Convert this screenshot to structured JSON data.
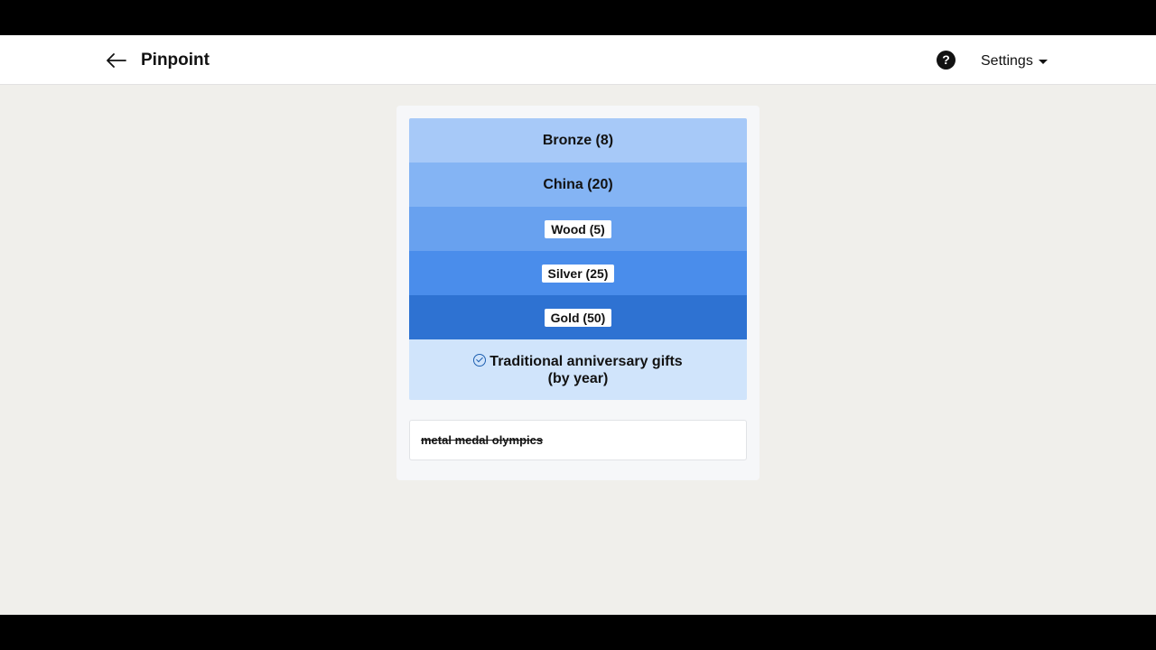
{
  "header": {
    "title": "Pinpoint",
    "help_label": "?",
    "settings_label": "Settings"
  },
  "clues": [
    {
      "label": "Bronze (8)"
    },
    {
      "label": "China (20)"
    },
    {
      "label": "Wood (5)"
    },
    {
      "label": "Silver (25)"
    },
    {
      "label": "Gold (50)"
    }
  ],
  "answer": {
    "category": "Traditional anniversary gifts (by year)",
    "status": "solved"
  },
  "guesses": [
    {
      "text": "metal medal olympics",
      "status": "incorrect"
    }
  ],
  "colors": {
    "clue_1": "#a7c9f8",
    "clue_2": "#84b4f4",
    "clue_3": "#68a1ef",
    "clue_4": "#4a8deb",
    "clue_5": "#2e72d2",
    "answer_bg": "#d0e4fb"
  }
}
